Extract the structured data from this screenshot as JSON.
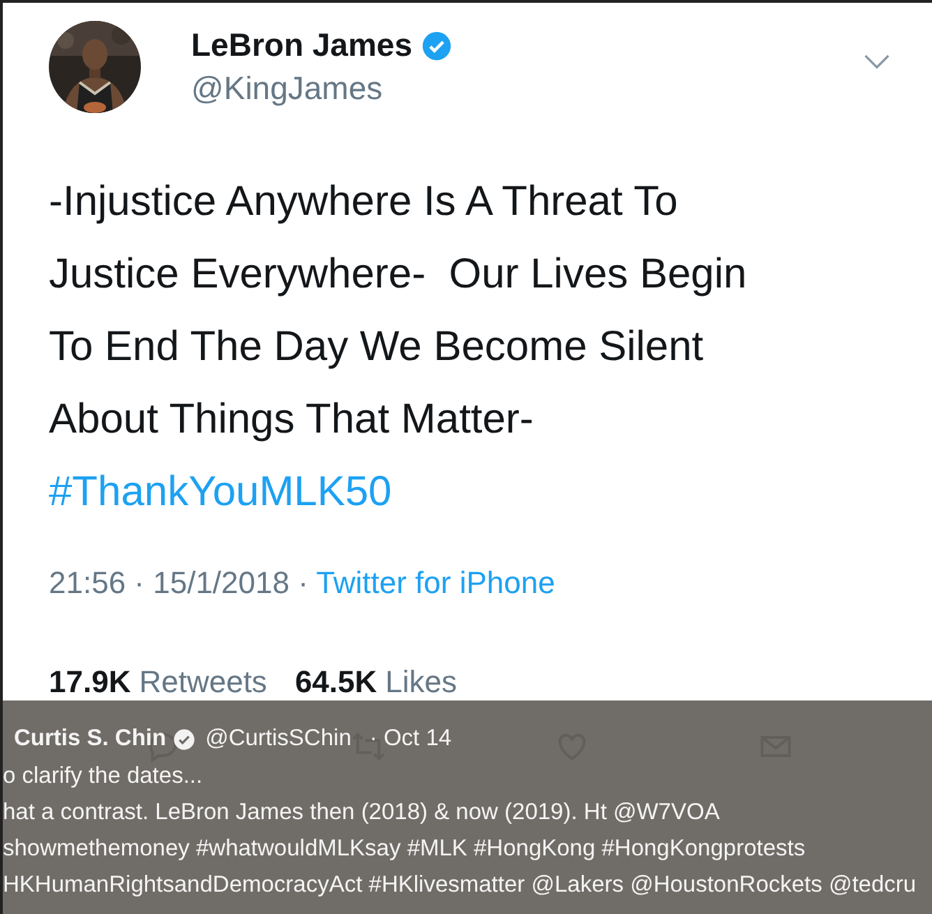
{
  "tweet": {
    "name": "LeBron James",
    "verified": true,
    "handle": "@KingJames",
    "text": [
      "-Injustice Anywhere Is A Threat To",
      "Justice Everywhere-  Our Lives Begin",
      "To End The Day We Become Silent",
      "About Things That Matter-"
    ],
    "hashtag": "#ThankYouMLK50",
    "time": "21:56 · 15/1/2018 · ",
    "source": "Twitter for iPhone",
    "retweets": "17.9K",
    "retweets_label": "Retweets",
    "likes": "64.5K",
    "likes_label": "Likes"
  },
  "overlay": {
    "name": "Curtis S. Chin",
    "verified": true,
    "handle": "@CurtisSChin",
    "date": "· Oct 14",
    "lines": [
      "o clarify the dates...",
      "hat a contrast. LeBron James then (2018) & now (2019). Ht @W7VOA",
      "showmethemoney #whatwouldMLKsay #MLK #HongKong #HongKongprotests",
      "HKHumanRightsandDemocracyAct #HKlivesmatter @Lakers @HoustonRockets @tedcru"
    ]
  }
}
